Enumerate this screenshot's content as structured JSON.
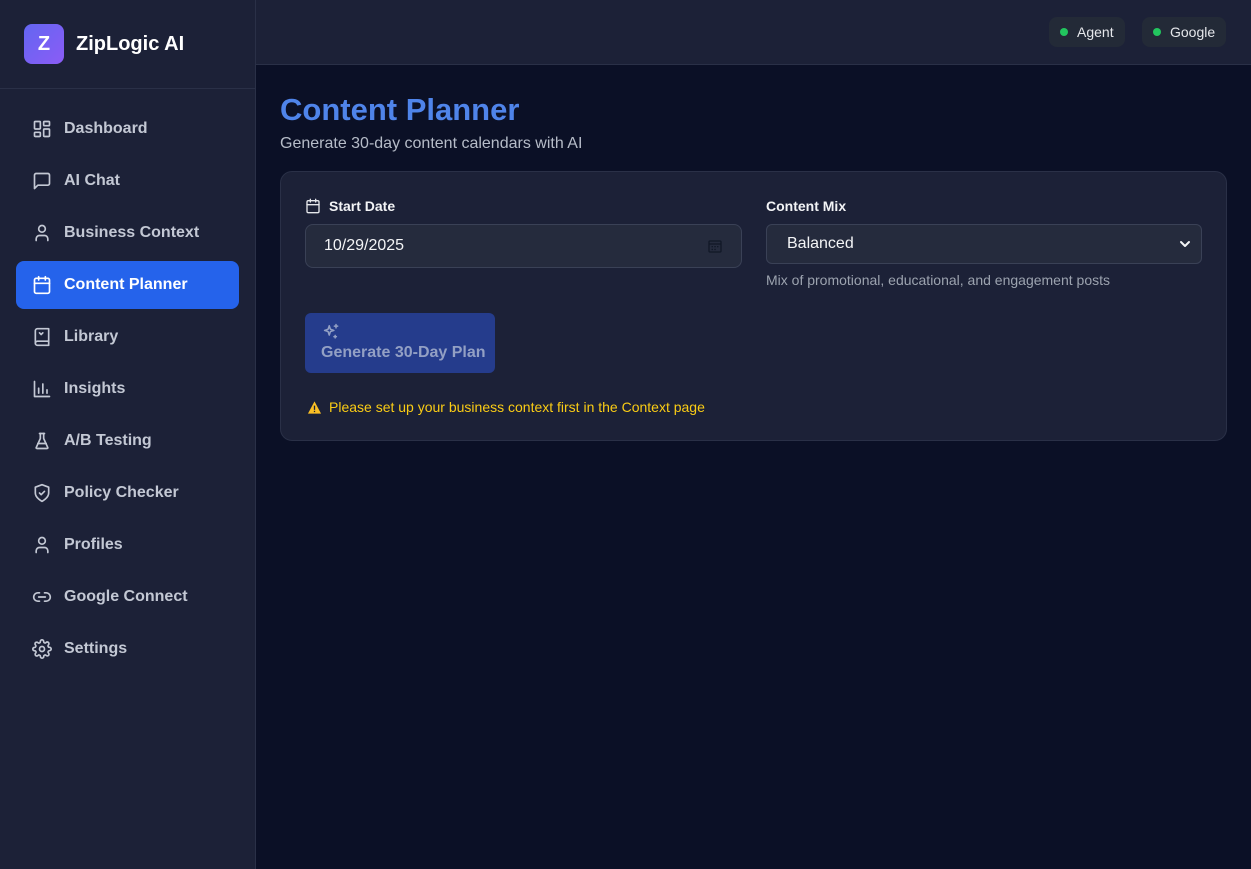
{
  "brand": {
    "logo_letter": "Z",
    "name": "ZipLogic AI"
  },
  "sidebar": {
    "items": [
      {
        "label": "Dashboard",
        "icon": "dashboard-icon",
        "active": false
      },
      {
        "label": "AI Chat",
        "icon": "chat-icon",
        "active": false
      },
      {
        "label": "Business Context",
        "icon": "user-icon",
        "active": false
      },
      {
        "label": "Content Planner",
        "icon": "calendar-icon",
        "active": true
      },
      {
        "label": "Library",
        "icon": "book-icon",
        "active": false
      },
      {
        "label": "Insights",
        "icon": "bar-chart-icon",
        "active": false
      },
      {
        "label": "A/B Testing",
        "icon": "flask-icon",
        "active": false
      },
      {
        "label": "Policy Checker",
        "icon": "shield-check-icon",
        "active": false
      },
      {
        "label": "Profiles",
        "icon": "user-icon",
        "active": false
      },
      {
        "label": "Google Connect",
        "icon": "link-icon",
        "active": false
      },
      {
        "label": "Settings",
        "icon": "gear-icon",
        "active": false
      }
    ]
  },
  "topbar": {
    "status": [
      {
        "label": "Agent",
        "color": "#22c55e"
      },
      {
        "label": "Google",
        "color": "#22c55e"
      }
    ]
  },
  "main": {
    "title": "Content Planner",
    "subtitle": "Generate 30-day content calendars with AI",
    "form": {
      "start_date_label": "Start Date",
      "start_date_value": "10/29/2025",
      "content_mix_label": "Content Mix",
      "content_mix_value": "Balanced",
      "content_mix_hint": "Mix of promotional, educational, and engagement posts",
      "generate_label": "Generate 30-Day Plan",
      "warning": "Please set up your business context first in the Context page"
    }
  },
  "colors": {
    "accent": "#2563eb",
    "title": "#4f84ea",
    "warning": "#facc15",
    "status_ok": "#22c55e"
  }
}
